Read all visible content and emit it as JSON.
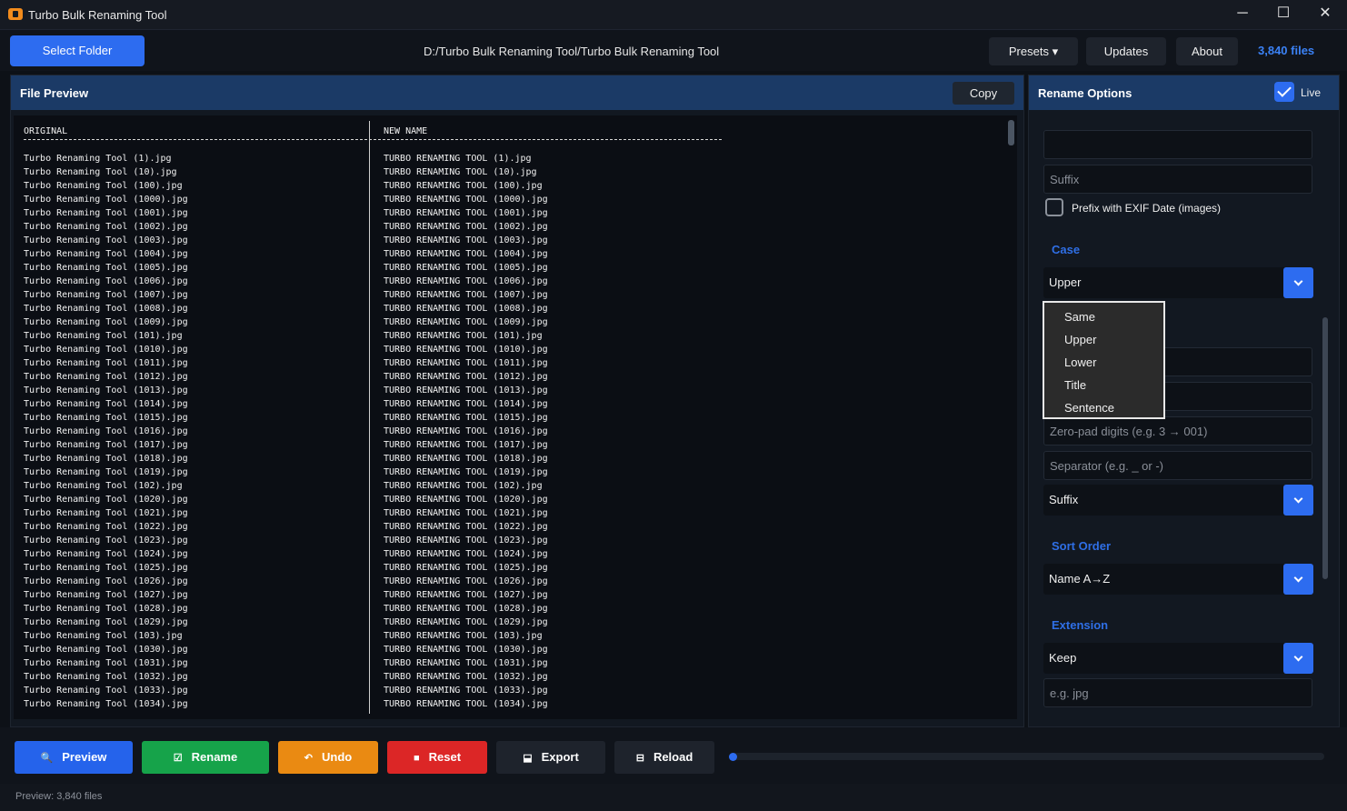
{
  "window": {
    "title": "Turbo Bulk Renaming Tool",
    "minimize": "─",
    "maximize": "☐",
    "close": "✕"
  },
  "toolbar": {
    "select_folder": "Select Folder",
    "path": "D:/Turbo Bulk Renaming Tool/Turbo Bulk Renaming Tool",
    "presets": "Presets ▾",
    "updates": "Updates",
    "about": "About",
    "file_count": "3,840 files"
  },
  "preview": {
    "title": "File Preview",
    "copy": "Copy",
    "original_header": "ORIGINAL",
    "new_header": "NEW NAME",
    "original": [
      "Turbo Renaming Tool (1).jpg",
      "Turbo Renaming Tool (10).jpg",
      "Turbo Renaming Tool (100).jpg",
      "Turbo Renaming Tool (1000).jpg",
      "Turbo Renaming Tool (1001).jpg",
      "Turbo Renaming Tool (1002).jpg",
      "Turbo Renaming Tool (1003).jpg",
      "Turbo Renaming Tool (1004).jpg",
      "Turbo Renaming Tool (1005).jpg",
      "Turbo Renaming Tool (1006).jpg",
      "Turbo Renaming Tool (1007).jpg",
      "Turbo Renaming Tool (1008).jpg",
      "Turbo Renaming Tool (1009).jpg",
      "Turbo Renaming Tool (101).jpg",
      "Turbo Renaming Tool (1010).jpg",
      "Turbo Renaming Tool (1011).jpg",
      "Turbo Renaming Tool (1012).jpg",
      "Turbo Renaming Tool (1013).jpg",
      "Turbo Renaming Tool (1014).jpg",
      "Turbo Renaming Tool (1015).jpg",
      "Turbo Renaming Tool (1016).jpg",
      "Turbo Renaming Tool (1017).jpg",
      "Turbo Renaming Tool (1018).jpg",
      "Turbo Renaming Tool (1019).jpg",
      "Turbo Renaming Tool (102).jpg",
      "Turbo Renaming Tool (1020).jpg",
      "Turbo Renaming Tool (1021).jpg",
      "Turbo Renaming Tool (1022).jpg",
      "Turbo Renaming Tool (1023).jpg",
      "Turbo Renaming Tool (1024).jpg",
      "Turbo Renaming Tool (1025).jpg",
      "Turbo Renaming Tool (1026).jpg",
      "Turbo Renaming Tool (1027).jpg",
      "Turbo Renaming Tool (1028).jpg",
      "Turbo Renaming Tool (1029).jpg",
      "Turbo Renaming Tool (103).jpg",
      "Turbo Renaming Tool (1030).jpg",
      "Turbo Renaming Tool (1031).jpg",
      "Turbo Renaming Tool (1032).jpg",
      "Turbo Renaming Tool (1033).jpg",
      "Turbo Renaming Tool (1034).jpg"
    ],
    "renamed": [
      "TURBO RENAMING TOOL (1).jpg",
      "TURBO RENAMING TOOL (10).jpg",
      "TURBO RENAMING TOOL (100).jpg",
      "TURBO RENAMING TOOL (1000).jpg",
      "TURBO RENAMING TOOL (1001).jpg",
      "TURBO RENAMING TOOL (1002).jpg",
      "TURBO RENAMING TOOL (1003).jpg",
      "TURBO RENAMING TOOL (1004).jpg",
      "TURBO RENAMING TOOL (1005).jpg",
      "TURBO RENAMING TOOL (1006).jpg",
      "TURBO RENAMING TOOL (1007).jpg",
      "TURBO RENAMING TOOL (1008).jpg",
      "TURBO RENAMING TOOL (1009).jpg",
      "TURBO RENAMING TOOL (101).jpg",
      "TURBO RENAMING TOOL (1010).jpg",
      "TURBO RENAMING TOOL (1011).jpg",
      "TURBO RENAMING TOOL (1012).jpg",
      "TURBO RENAMING TOOL (1013).jpg",
      "TURBO RENAMING TOOL (1014).jpg",
      "TURBO RENAMING TOOL (1015).jpg",
      "TURBO RENAMING TOOL (1016).jpg",
      "TURBO RENAMING TOOL (1017).jpg",
      "TURBO RENAMING TOOL (1018).jpg",
      "TURBO RENAMING TOOL (1019).jpg",
      "TURBO RENAMING TOOL (102).jpg",
      "TURBO RENAMING TOOL (1020).jpg",
      "TURBO RENAMING TOOL (1021).jpg",
      "TURBO RENAMING TOOL (1022).jpg",
      "TURBO RENAMING TOOL (1023).jpg",
      "TURBO RENAMING TOOL (1024).jpg",
      "TURBO RENAMING TOOL (1025).jpg",
      "TURBO RENAMING TOOL (1026).jpg",
      "TURBO RENAMING TOOL (1027).jpg",
      "TURBO RENAMING TOOL (1028).jpg",
      "TURBO RENAMING TOOL (1029).jpg",
      "TURBO RENAMING TOOL (103).jpg",
      "TURBO RENAMING TOOL (1030).jpg",
      "TURBO RENAMING TOOL (1031).jpg",
      "TURBO RENAMING TOOL (1032).jpg",
      "TURBO RENAMING TOOL (1033).jpg",
      "TURBO RENAMING TOOL (1034).jpg"
    ]
  },
  "options": {
    "title": "Rename Options",
    "live_label": "Live",
    "live_checked": true,
    "prefix_value": "",
    "suffix_placeholder": "Suffix",
    "exif_label": "Prefix with EXIF Date (images)",
    "exif_checked": false,
    "case_title": "Case",
    "case_selected": "Upper",
    "case_options": [
      "Same",
      "Upper",
      "Lower",
      "Title",
      "Sentence"
    ],
    "zero_pad_placeholder": "Zero-pad digits (e.g. 3 → 001)",
    "separator_placeholder": "Separator (e.g. _ or -)",
    "number_position": "Suffix",
    "sort_title": "Sort Order",
    "sort_selected": "Name A→Z",
    "extension_title": "Extension",
    "extension_selected": "Keep",
    "extension_placeholder": "e.g. jpg"
  },
  "actions": {
    "preview": "Preview",
    "rename": "Rename",
    "undo": "Undo",
    "reset": "Reset",
    "export": "Export",
    "reload": "Reload",
    "progress": 0
  },
  "status": {
    "text": "Preview: 3,840 files"
  },
  "colors": {
    "accent": "#2d6cf0",
    "preview_btn": "#2563eb",
    "rename_btn": "#16a34a",
    "undo_btn": "#ea8a12",
    "reset_btn": "#dc2626",
    "section_title": "#2f6fe6"
  }
}
